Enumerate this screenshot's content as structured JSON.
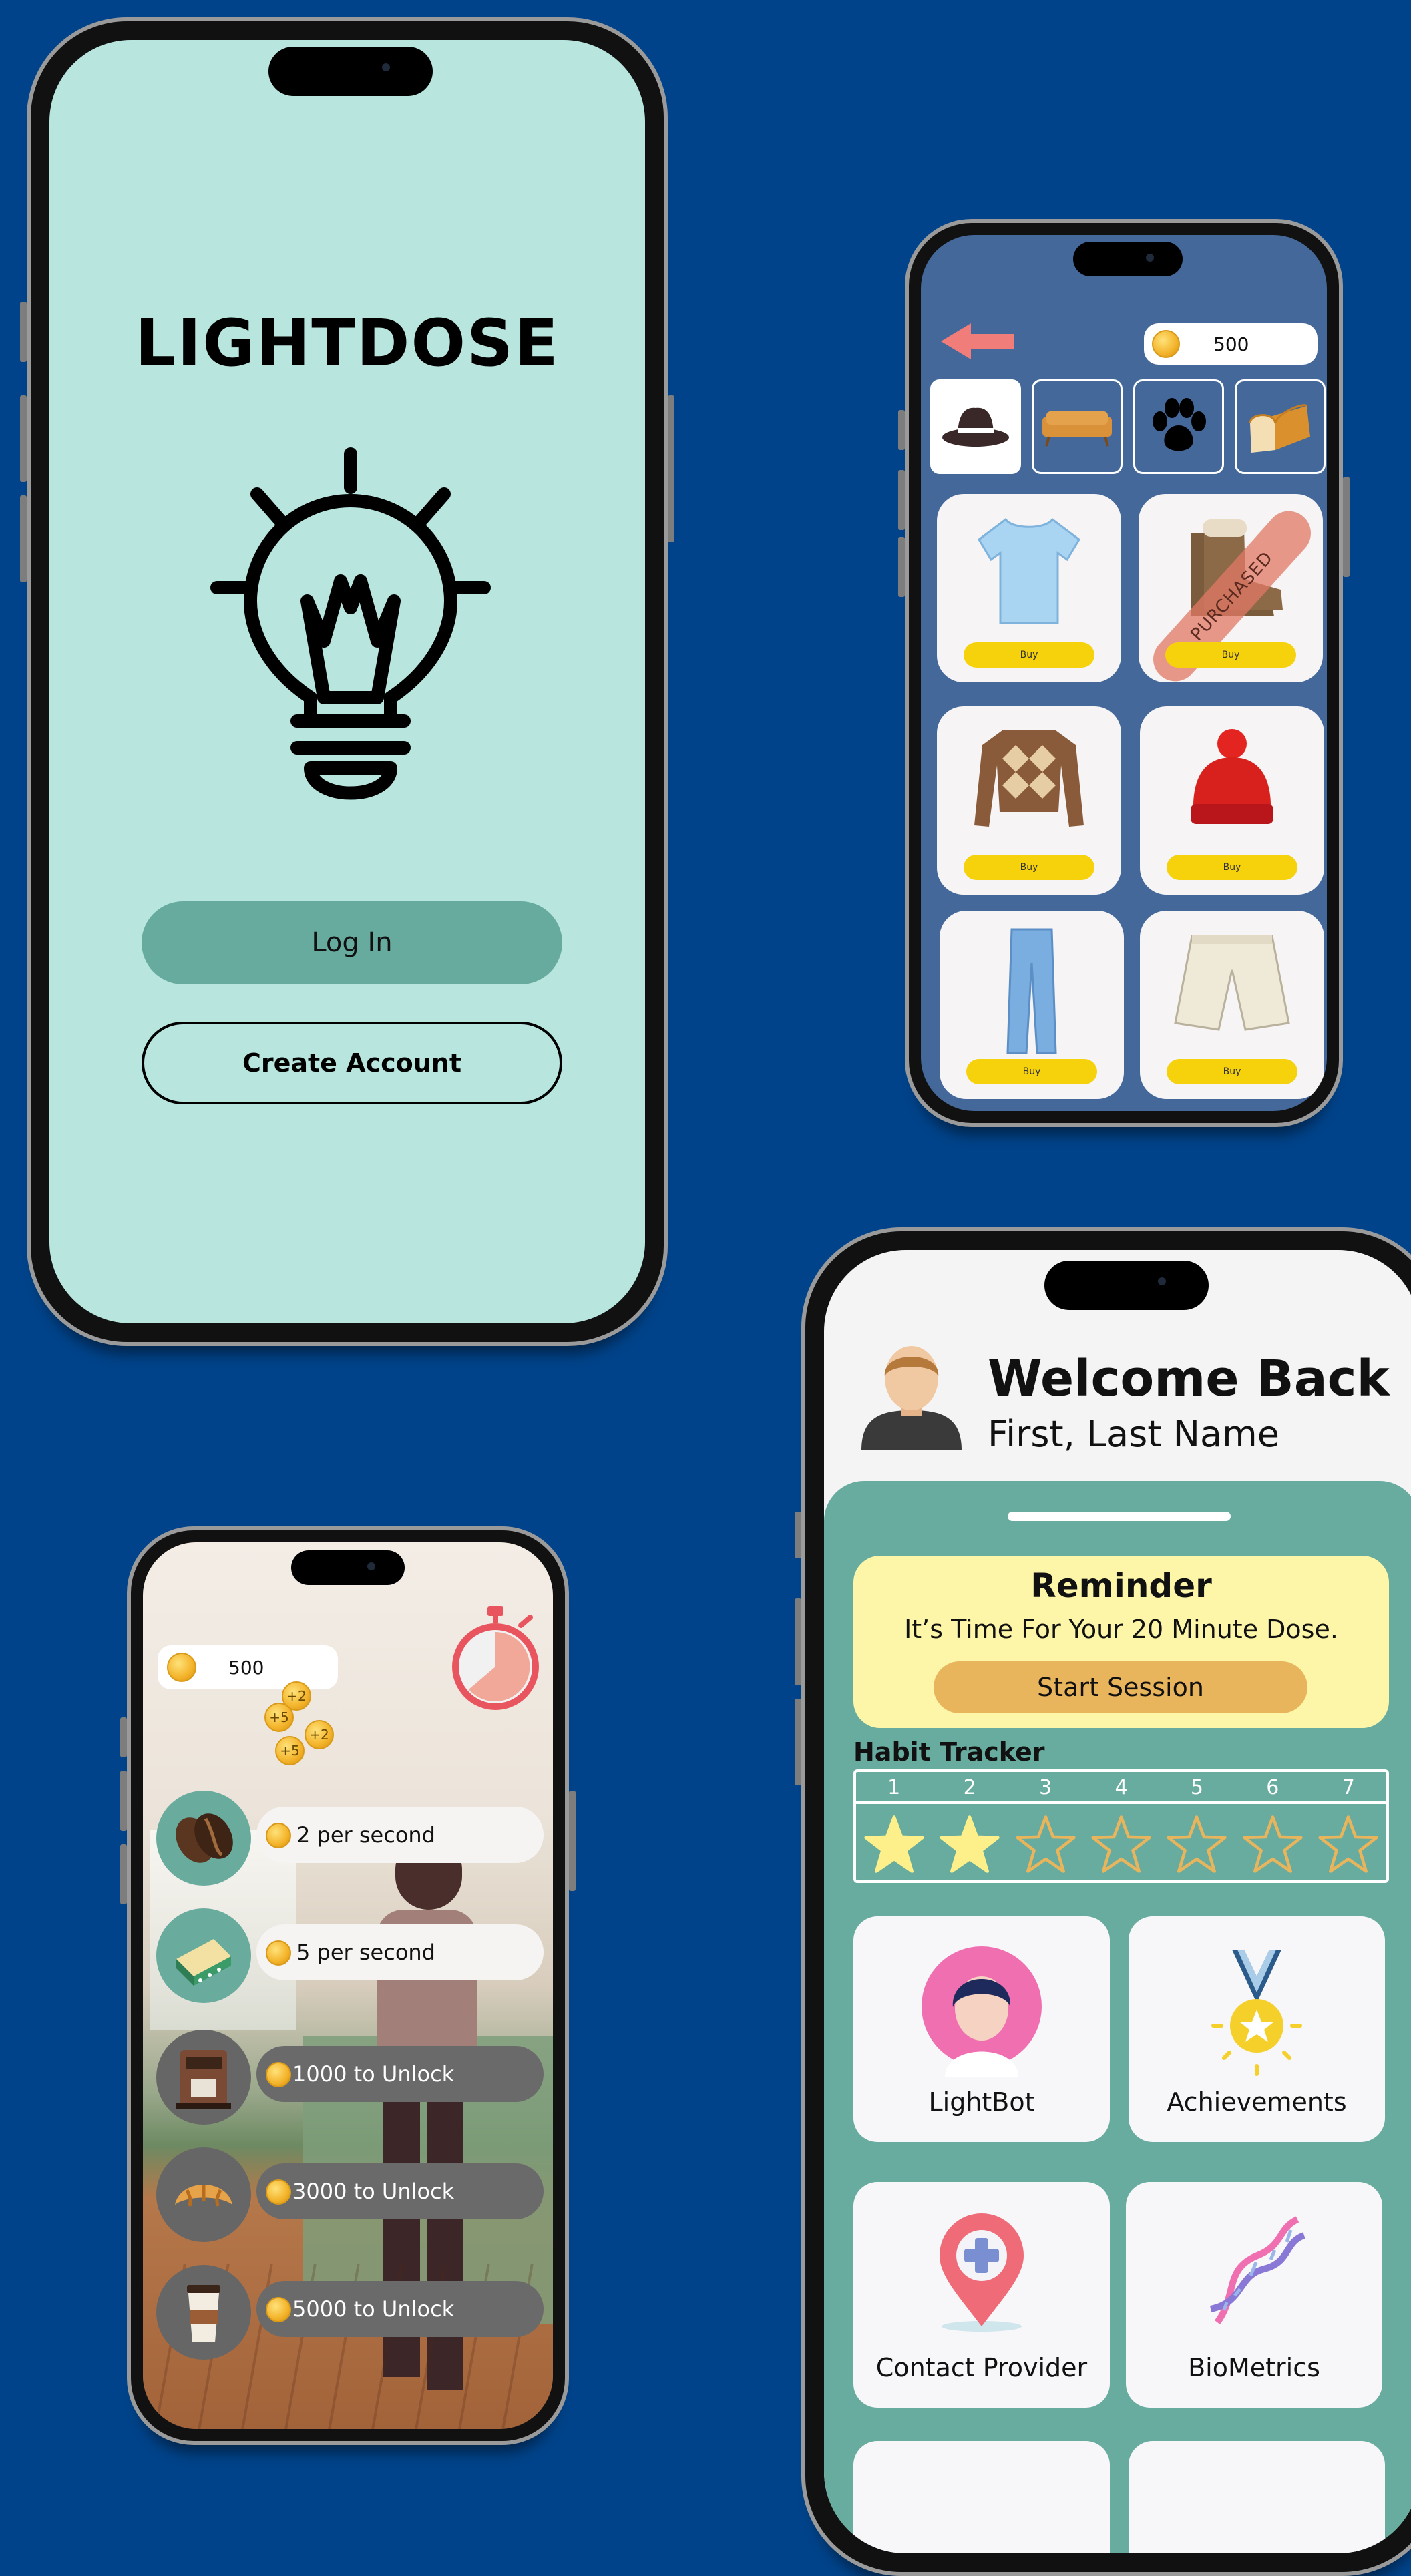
{
  "login_screen": {
    "app_title": "LIGHTDOSE",
    "login_label": "Log In",
    "create_account_label": "Create Account"
  },
  "shop_screen": {
    "coin_balance": "500",
    "categories": [
      "hat-icon",
      "sofa-icon",
      "paw-icon",
      "bread-icon"
    ],
    "items": [
      {
        "name": "t-shirt",
        "buy_label": "Buy",
        "purchased": false
      },
      {
        "name": "boots",
        "buy_label": "Buy",
        "purchased": true,
        "stamp": "PURCHASED"
      },
      {
        "name": "sweater",
        "buy_label": "Buy",
        "purchased": false
      },
      {
        "name": "beanie",
        "buy_label": "Buy",
        "purchased": false
      },
      {
        "name": "jeans",
        "buy_label": "Buy",
        "purchased": false
      },
      {
        "name": "shorts",
        "buy_label": "Buy",
        "purchased": false
      }
    ]
  },
  "idle_screen": {
    "coin_balance": "500",
    "coin_popups": [
      "+2",
      "+5",
      "+2",
      "+5"
    ],
    "upgrades": [
      {
        "icon": "coffee-bean-icon",
        "label": "2 per second",
        "locked": false
      },
      {
        "icon": "cake-icon",
        "label": "5 per second",
        "locked": false
      },
      {
        "icon": "espresso-machine-icon",
        "label": "1000 to Unlock",
        "locked": true
      },
      {
        "icon": "croissant-icon",
        "label": "3000 to Unlock",
        "locked": true
      },
      {
        "icon": "coffee-cup-icon",
        "label": "5000 to Unlock",
        "locked": true
      }
    ]
  },
  "home_screen": {
    "welcome": "Welcome Back",
    "user_name": "First, Last Name",
    "reminder": {
      "title": "Reminder",
      "message": "It’s Time For Your 20 Minute Dose.",
      "button": "Start Session"
    },
    "habit_tracker": {
      "title": "Habit Tracker",
      "days": [
        "1",
        "2",
        "3",
        "4",
        "5",
        "6",
        "7"
      ],
      "completed": 2
    },
    "tiles": [
      {
        "label": "LightBot",
        "icon": "robot-avatar-icon"
      },
      {
        "label": "Achievements",
        "icon": "medal-icon"
      },
      {
        "label": "Contact Provider",
        "icon": "location-pin-icon"
      },
      {
        "label": "BioMetrics",
        "icon": "dna-icon"
      }
    ]
  },
  "colors": {
    "background": "#00438a",
    "mint": "#b8e6df",
    "teal": "#67ab9f",
    "shop_blue": "#44689a",
    "buy_yellow": "#f6d20d",
    "reminder_yellow": "#fdf5a8",
    "session_orange": "#e8b45c"
  }
}
